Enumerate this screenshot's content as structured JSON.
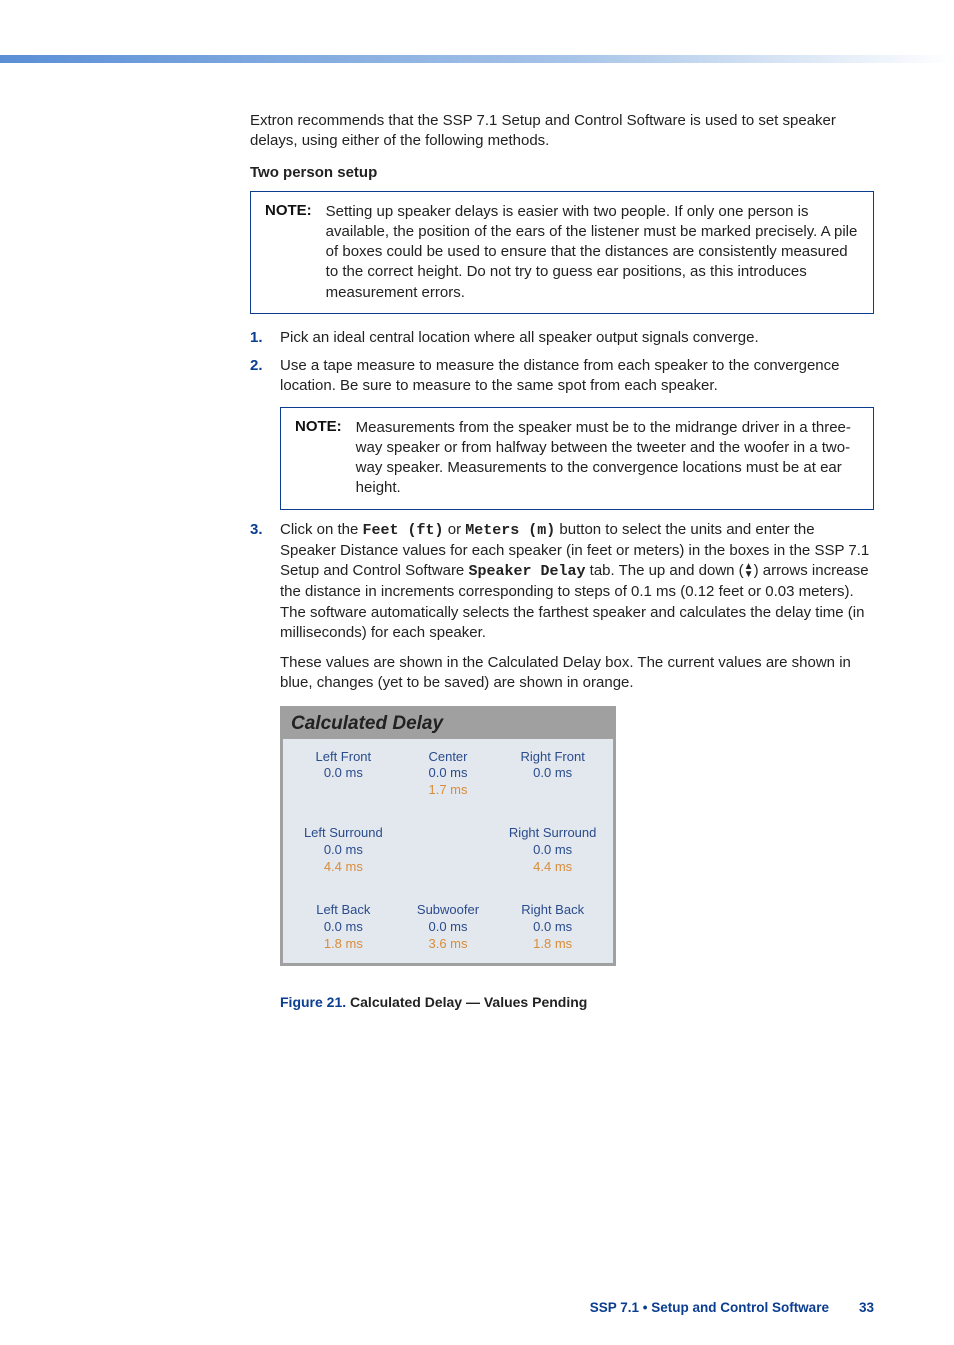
{
  "intro": "Extron recommends that the SSP 7.1 Setup and Control Software is used to set speaker delays, using either of the following methods.",
  "subhead": "Two person setup",
  "note1": {
    "label": "NOTE:",
    "text": "Setting up speaker delays is easier with two people. If only one person is available, the position of the ears of the listener must be marked precisely. A pile of boxes could be used to ensure that the distances are consistently measured to the correct height. Do not try to guess ear positions, as this introduces measurement errors."
  },
  "steps": {
    "s1": "Pick an ideal central location where all speaker output signals converge.",
    "s2": "Use a tape measure to measure the distance from each speaker to the convergence location. Be sure to measure to the same spot from each speaker.",
    "s3a": "Click on the ",
    "s3_feet": "Feet (ft)",
    "s3b": " or ",
    "s3_meters": "Meters (m)",
    "s3c": " button to select the units and enter the Speaker Distance values for each speaker (in feet or meters) in the boxes in the SSP 7.1 Setup and Control Software ",
    "s3_tab": "Speaker Delay",
    "s3d": " tab. The up and down (",
    "s3e": ") arrows increase the distance in increments corresponding to steps of 0.1 ms (0.12 feet or 0.03 meters). The software automatically selects the farthest speaker and calculates the delay time (in milliseconds) for each speaker."
  },
  "note2": {
    "label": "NOTE:",
    "text": "Measurements from the speaker must be to the midrange driver in a three-way speaker or from halfway between the tweeter and the woofer in a two-way speaker. Measurements to the convergence locations must be at ear height."
  },
  "extra": "These values are shown in the Calculated Delay box. The current values are shown in blue, changes (yet to be saved) are shown in orange.",
  "panel": {
    "title": "Calculated Delay",
    "cells": {
      "lf": {
        "name": "Left Front",
        "current": "0.0 ms",
        "pending": ""
      },
      "c": {
        "name": "Center",
        "current": "0.0 ms",
        "pending": "1.7 ms"
      },
      "rf": {
        "name": "Right Front",
        "current": "0.0 ms",
        "pending": ""
      },
      "ls": {
        "name": "Left Surround",
        "current": "0.0 ms",
        "pending": "4.4 ms"
      },
      "mid": {
        "name": "",
        "current": "",
        "pending": ""
      },
      "rs": {
        "name": "Right Surround",
        "current": "0.0 ms",
        "pending": "4.4 ms"
      },
      "lb": {
        "name": "Left Back",
        "current": "0.0 ms",
        "pending": "1.8 ms"
      },
      "sw": {
        "name": "Subwoofer",
        "current": "0.0 ms",
        "pending": "3.6 ms"
      },
      "rb": {
        "name": "Right Back",
        "current": "0.0 ms",
        "pending": "1.8 ms"
      }
    }
  },
  "figure": {
    "label": "Figure 21.",
    "text": "  Calculated Delay — Values Pending"
  },
  "footer": {
    "title": "SSP 7.1 • Setup and Control Software",
    "page": "33"
  }
}
